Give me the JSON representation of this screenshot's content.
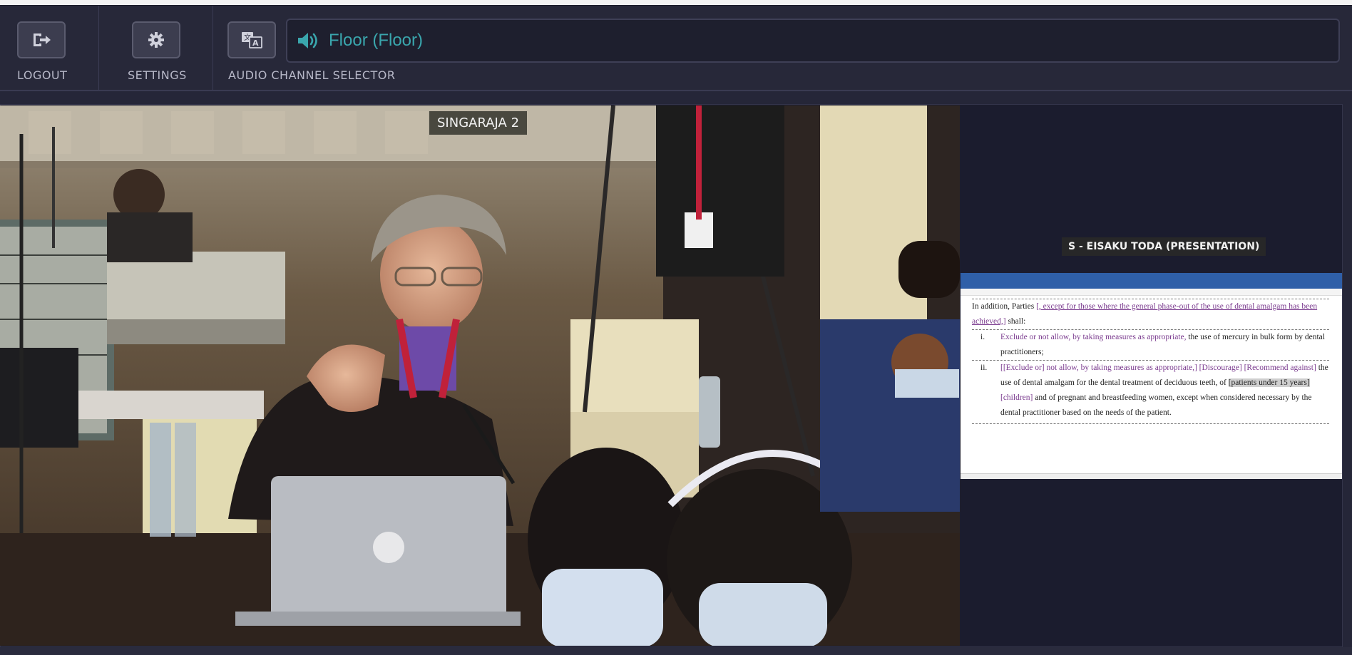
{
  "toolbar": {
    "logout_label": "LOGOUT",
    "settings_label": "SETTINGS",
    "audio_channel_label": "AUDIO CHANNEL SELECTOR"
  },
  "channel": {
    "current": "Floor (Floor)",
    "accent_color": "#3aa6ad"
  },
  "main_video": {
    "room_label": "SINGARAJA 2"
  },
  "presentation": {
    "label": "S - EISAKU TODA (PRESENTATION)",
    "doc": {
      "intro_plain": "In addition, Parties ",
      "intro_insert": "[, except for those where the general phase-out of the use of dental amalgam has been achieved,]",
      "intro_end": " shall:",
      "item1_num": "i.",
      "item1_insert": "Exclude or not allow, by taking measures as appropriate,",
      "item1_rest": " the use of mercury in bulk form by dental practitioners;",
      "item2_num": "ii.",
      "item2_insert": "[[Exclude or] not allow, by taking measures as appropriate,] [Discourage] [Recommend against]",
      "item2_mid": " the use of dental amalgam for the dental treatment of deciduous teeth, of ",
      "item2_hl": "[patients under 15 years]",
      "item2_children": " [children]",
      "item2_rest": " and of pregnant and breastfeeding women, except when considered necessary by the dental practitioner based on the needs of the patient."
    }
  },
  "icons": {
    "logout": "logout-icon",
    "settings": "gear-icon",
    "translate": "translate-icon",
    "speaker": "speaker-icon"
  }
}
